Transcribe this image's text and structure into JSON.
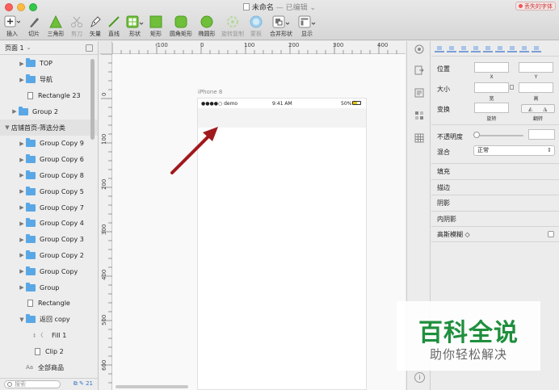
{
  "window": {
    "title": "未命名",
    "edited_suffix": "— 已编辑",
    "missing_fonts_badge": "丢失的字体"
  },
  "toolbar": {
    "insert": "插入",
    "slice": "切片",
    "triangle": "三角形",
    "scissors": "剪刀",
    "vector": "矢量",
    "line": "直线",
    "shape": "形状",
    "rectangle": "矩形",
    "rounded_rect": "圆角矩形",
    "oval": "椭圆形",
    "rotate_copies": "旋转复制",
    "mask": "蒙板",
    "combine": "合并形状",
    "view": "显示"
  },
  "layers": {
    "page_selector": "页面 1",
    "items": [
      {
        "label": "TOP",
        "type": "group",
        "indent": 2
      },
      {
        "label": "导航",
        "type": "group",
        "indent": 2
      },
      {
        "label": "Rectangle 23",
        "type": "rect",
        "indent": 2
      },
      {
        "label": "Group 2",
        "type": "group",
        "indent": 1
      },
      {
        "label": "店铺首页-筛选分类",
        "type": "artboard",
        "indent": 0
      },
      {
        "label": "Group Copy 9",
        "type": "group",
        "indent": 2
      },
      {
        "label": "Group Copy 6",
        "type": "group",
        "indent": 2
      },
      {
        "label": "Group Copy 8",
        "type": "group",
        "indent": 2
      },
      {
        "label": "Group Copy 5",
        "type": "group",
        "indent": 2
      },
      {
        "label": "Group Copy 7",
        "type": "group",
        "indent": 2
      },
      {
        "label": "Group Copy 4",
        "type": "group",
        "indent": 2
      },
      {
        "label": "Group Copy 3",
        "type": "group",
        "indent": 2
      },
      {
        "label": "Group Copy 2",
        "type": "group",
        "indent": 2
      },
      {
        "label": "Group Copy",
        "type": "group",
        "indent": 2
      },
      {
        "label": "Group",
        "type": "group",
        "indent": 2
      },
      {
        "label": "Rectangle",
        "type": "rect",
        "indent": 2
      },
      {
        "label": "返回 copy",
        "type": "group-open",
        "indent": 2
      },
      {
        "label": "Fill 1",
        "type": "path",
        "indent": 3
      },
      {
        "label": "Clip 2",
        "type": "rect",
        "indent": 3
      },
      {
        "label": "全部商品",
        "type": "text",
        "indent": 2
      }
    ],
    "search_placeholder": "搜索",
    "count": "21"
  },
  "canvas": {
    "ruler_top_labels": [
      "-100",
      "0",
      "100",
      "200",
      "300",
      "400"
    ],
    "ruler_left_labels": [
      "0",
      "100",
      "200",
      "300",
      "400",
      "500",
      "600"
    ],
    "artboard_label": "iPhone 8",
    "status": {
      "carrier": "●●●●○ demo",
      "time": "9:41 AM",
      "battery": "50%",
      "battery_level": 0.5
    }
  },
  "inspector": {
    "position": "位置",
    "x": "X",
    "y": "Y",
    "size": "大小",
    "width": "宽",
    "height": "高",
    "transform": "变换",
    "rotate": "旋转",
    "flip": "翻转",
    "opacity": "不透明度",
    "opacity_level": 0,
    "blending": "混合",
    "blend_mode": "正常",
    "sections": [
      "填充",
      "描边",
      "阴影",
      "内阴影",
      "高斯模糊 ◇"
    ]
  },
  "watermark": {
    "main": "百科全说",
    "sub": "助你轻松解决"
  },
  "colors": {
    "folder": "#5aa7e6",
    "arrow": "#a0191c",
    "watermark_green": "#1f8f3d",
    "missing_font": "#cc3333"
  }
}
